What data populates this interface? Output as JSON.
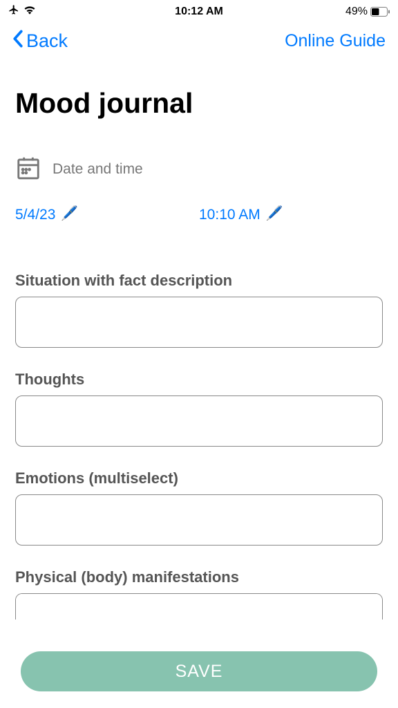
{
  "status": {
    "time": "10:12 AM",
    "battery_pct": "49%"
  },
  "nav": {
    "back_label": "Back",
    "guide_label": "Online Guide"
  },
  "title": "Mood journal",
  "datetime": {
    "label": "Date and time",
    "date_value": "5/4/23",
    "time_value": "10:10 AM"
  },
  "sections": {
    "situation": {
      "label": "Situation with fact description"
    },
    "thoughts": {
      "label": "Thoughts"
    },
    "emotions": {
      "label": "Emotions (multiselect)"
    },
    "physical": {
      "label": "Physical (body) manifestations"
    }
  },
  "save_label": "SAVE"
}
